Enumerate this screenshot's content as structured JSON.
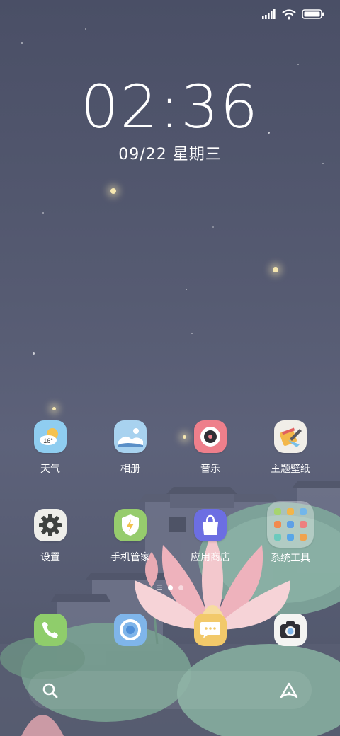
{
  "lockscreen": {
    "time": "02:36",
    "date": "09/22 星期三"
  },
  "apps_row1": [
    {
      "label": "天气",
      "icon": "weather-icon"
    },
    {
      "label": "相册",
      "icon": "gallery-icon"
    },
    {
      "label": "音乐",
      "icon": "music-icon"
    },
    {
      "label": "主题壁纸",
      "icon": "themes-icon"
    }
  ],
  "apps_row2": [
    {
      "label": "设置",
      "icon": "settings-gear-icon"
    },
    {
      "label": "手机管家",
      "icon": "security-shield-icon"
    },
    {
      "label": "应用商店",
      "icon": "app-store-bag-icon"
    },
    {
      "label": "系统工具",
      "icon": "folder-icon"
    }
  ],
  "weather_temp": "16°",
  "dock": [
    "phone-icon",
    "browser-icon",
    "messages-icon",
    "camera-icon"
  ],
  "page_indicator": {
    "pages": 2,
    "current": 1
  },
  "colors": {
    "weather": "#8fcdf0",
    "gallery": "#a8d2ef",
    "music": "#ee7f8b",
    "themes": "#f1eee8",
    "settings": "#eeeeea",
    "security": "#96cc6d",
    "store": "#6c6ee2",
    "folder": "rgba(255,255,255,0.35)",
    "phone": "#8fcd6b",
    "browser": "#7fb5ea",
    "messages": "#f2c96a",
    "camera": "#f4f4f2"
  }
}
